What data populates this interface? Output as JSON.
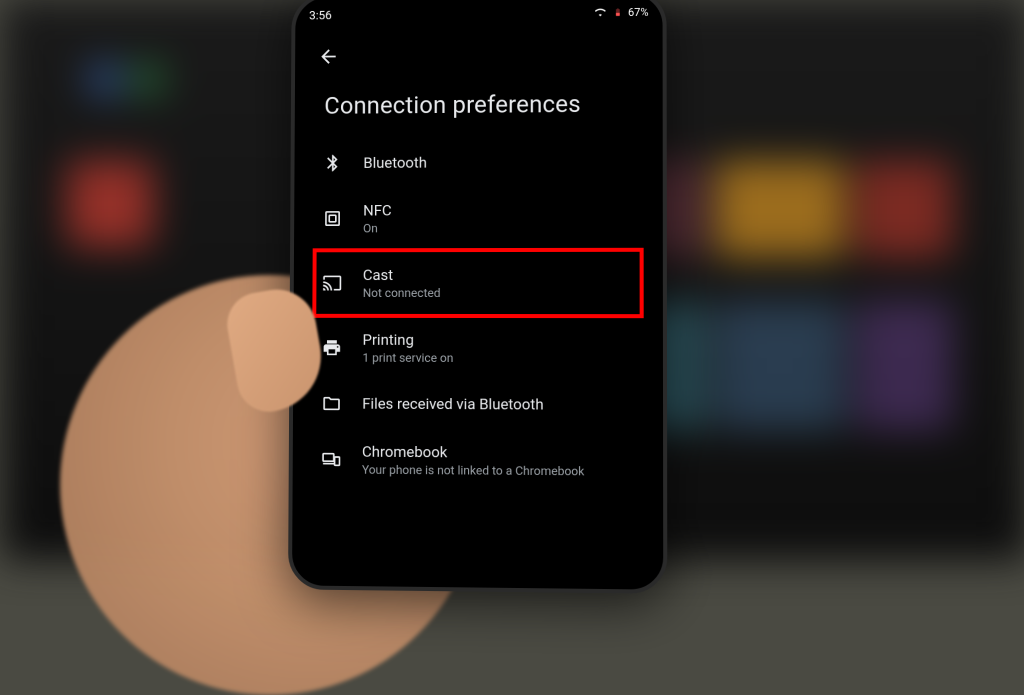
{
  "status_bar": {
    "time": "3:56",
    "battery_percent": "67%"
  },
  "page": {
    "title": "Connection preferences"
  },
  "items": {
    "bluetooth": {
      "title": "Bluetooth",
      "sub": ""
    },
    "nfc": {
      "title": "NFC",
      "sub": "On"
    },
    "cast": {
      "title": "Cast",
      "sub": "Not connected"
    },
    "printing": {
      "title": "Printing",
      "sub": "1 print service on"
    },
    "files_bt": {
      "title": "Files received via Bluetooth",
      "sub": ""
    },
    "chromebook": {
      "title": "Chromebook",
      "sub": "Your phone is not linked to a Chromebook"
    }
  }
}
